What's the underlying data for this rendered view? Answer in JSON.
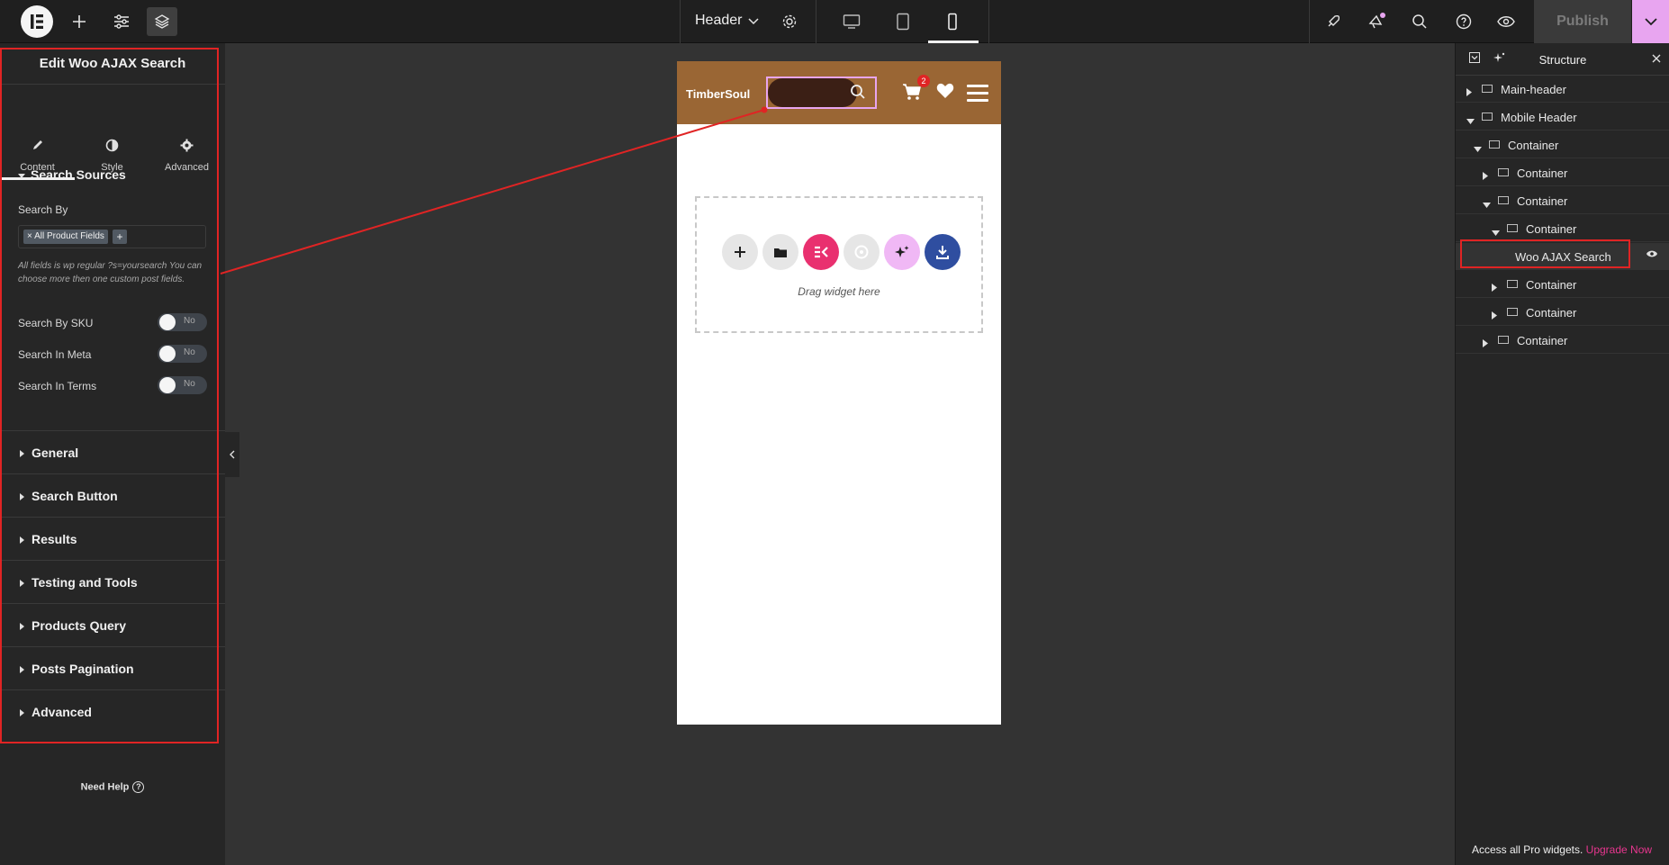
{
  "topbar": {
    "document_name": "Header",
    "publish_label": "Publish"
  },
  "left_panel": {
    "title": "Edit Woo AJAX Search",
    "tabs": [
      {
        "label": "Content",
        "icon": "pencil-icon"
      },
      {
        "label": "Style",
        "icon": "half-circle-icon"
      },
      {
        "label": "Advanced",
        "icon": "gear-icon"
      }
    ],
    "open_section": "Search Sources",
    "search_by_label": "Search By",
    "search_by_chip": "× All Product Fields",
    "search_by_add": "+",
    "help_text": "All fields is wp regular ?s=yoursearch You can choose more then one custom post fields.",
    "toggles": [
      {
        "label": "Search By SKU",
        "value": "No"
      },
      {
        "label": "Search In Meta",
        "value": "No"
      },
      {
        "label": "Search In Terms",
        "value": "No"
      }
    ],
    "collapsed_sections": [
      "General",
      "Search Button",
      "Results",
      "Testing and Tools",
      "Products Query",
      "Posts Pagination",
      "Advanced"
    ],
    "need_help": "Need Help"
  },
  "preview": {
    "site_logo": "TimberSoul",
    "cart_count": "2",
    "drop_text": "Drag widget here"
  },
  "structure": {
    "title": "Structure",
    "items": [
      {
        "label": "Main-header",
        "expanded": false
      },
      {
        "label": "Mobile Header",
        "expanded": true
      },
      {
        "label": "Container",
        "expanded": true
      },
      {
        "label": "Container",
        "expanded": false
      },
      {
        "label": "Container",
        "expanded": true
      },
      {
        "label": "Container",
        "expanded": true
      },
      {
        "label": "Woo AJAX Search",
        "selected": true
      },
      {
        "label": "Container",
        "expanded": false
      },
      {
        "label": "Container",
        "expanded": false
      },
      {
        "label": "Container",
        "expanded": false
      }
    ],
    "pro_text": "Access all Pro widgets.",
    "pro_link": "Upgrade Now"
  },
  "colors": {
    "accent_pink": "#e8a5f0",
    "annotation_red": "#e02424",
    "header_brown": "#9a6634"
  }
}
